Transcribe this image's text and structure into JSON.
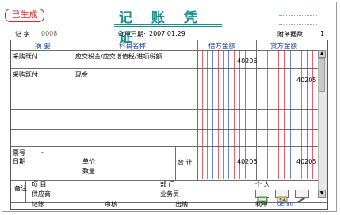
{
  "status_stamp": "已生成",
  "title": "记 账 凭 证",
  "header": {
    "voucher_word_label": "记 字",
    "voucher_number": "0008",
    "date_label": "制单日期:",
    "date_value": "2007.01.29",
    "attachments_label": "附单据数:",
    "attachments_value": "1"
  },
  "columns": {
    "summary": "摘  要",
    "account": "科目名称",
    "debit": "借方金额",
    "credit": "贷方金额"
  },
  "entries": [
    {
      "summary": "采购既付",
      "account": "应交税金/应交增值税/进项税额",
      "debit": "40205",
      "credit": ""
    },
    {
      "summary": "采购既付",
      "account": "现金",
      "debit": "",
      "credit": "40205"
    }
  ],
  "footer": {
    "ticket_no_label": "票号",
    "ticket_no_value": "-",
    "date_label": "日期",
    "unit_price_label": "单价",
    "quantity_label": "数量",
    "total_label": "合  计",
    "total_debit": "40205",
    "total_credit": "40205",
    "remarks_label": "备注",
    "project_label": "项  目",
    "department_label": "部  门",
    "individual_label": "个  人",
    "supplier_label": "供应商",
    "salesperson_label": "业务员"
  },
  "signatures": {
    "bookkeeping": "记账",
    "review": "审核",
    "cashier": "出纳",
    "prepared_by_label": "制单",
    "prepared_by_value": "demo"
  },
  "colors": {
    "stamp": "#e0202a",
    "title": "#1a8f8f",
    "amount_red_rule": "#e0202a",
    "amount_blue_rule": "#2a4fd0"
  },
  "icons": [
    "scroll-up-icon",
    "scroll-down-icon",
    "attachment-icon",
    "picture-icon",
    "edit-icon"
  ]
}
